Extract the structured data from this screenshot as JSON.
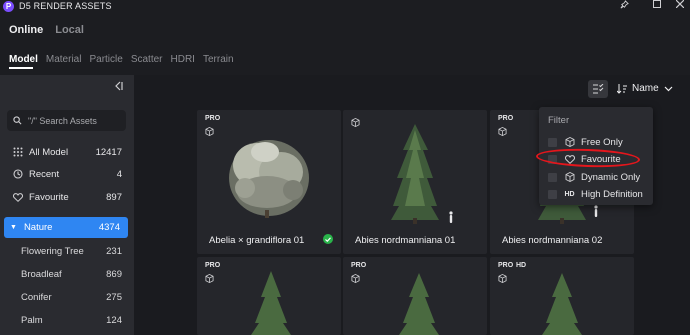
{
  "window": {
    "title": "D5 RENDER ASSETS",
    "logo_letter": "P"
  },
  "top_tabs": [
    {
      "label": "Online",
      "active": true
    },
    {
      "label": "Local",
      "active": false
    }
  ],
  "category_tabs": [
    "Model",
    "Material",
    "Particle",
    "Scatter",
    "HDRI",
    "Terrain"
  ],
  "sidebar": {
    "search_placeholder": "\"/\" Search Assets",
    "items": [
      {
        "label": "All Model",
        "count": "12417",
        "icon": "grid-icon"
      },
      {
        "label": "Recent",
        "count": "4",
        "icon": "clock-icon"
      },
      {
        "label": "Favourite",
        "count": "897",
        "icon": "heart-icon"
      }
    ],
    "selected": {
      "label": "Nature",
      "count": "4374"
    },
    "sub_items": [
      {
        "label": "Flowering Tree",
        "count": "231"
      },
      {
        "label": "Broadleaf",
        "count": "869"
      },
      {
        "label": "Conifer",
        "count": "275"
      },
      {
        "label": "Palm",
        "count": "124"
      }
    ]
  },
  "toolbar": {
    "sort_label": "Name"
  },
  "cards": [
    {
      "name": "Abelia × grandiflora 01",
      "badge": "PRO",
      "hd": "",
      "checked": true
    },
    {
      "name": "Abies nordmanniana 01",
      "badge": "",
      "hd": "",
      "checked": false
    },
    {
      "name": "Abies nordmanniana 02",
      "badge": "PRO",
      "hd": "",
      "checked": false
    },
    {
      "name": "",
      "badge": "PRO",
      "hd": "",
      "checked": false
    },
    {
      "name": "",
      "badge": "PRO",
      "hd": "",
      "checked": false
    },
    {
      "name": "",
      "badge": "PRO",
      "hd": "HD",
      "checked": false
    }
  ],
  "filter_menu": {
    "title": "Filter",
    "options": [
      {
        "label": "Free Only",
        "icon": "cube-icon"
      },
      {
        "label": "Favourite",
        "icon": "heart-icon"
      },
      {
        "label": "Dynamic Only",
        "icon": "cube-icon"
      },
      {
        "label": "High Definition",
        "icon": "HD"
      }
    ]
  },
  "colors": {
    "accent": "#2f86f2",
    "annotation": "#e4161c",
    "check": "#29b34a"
  }
}
